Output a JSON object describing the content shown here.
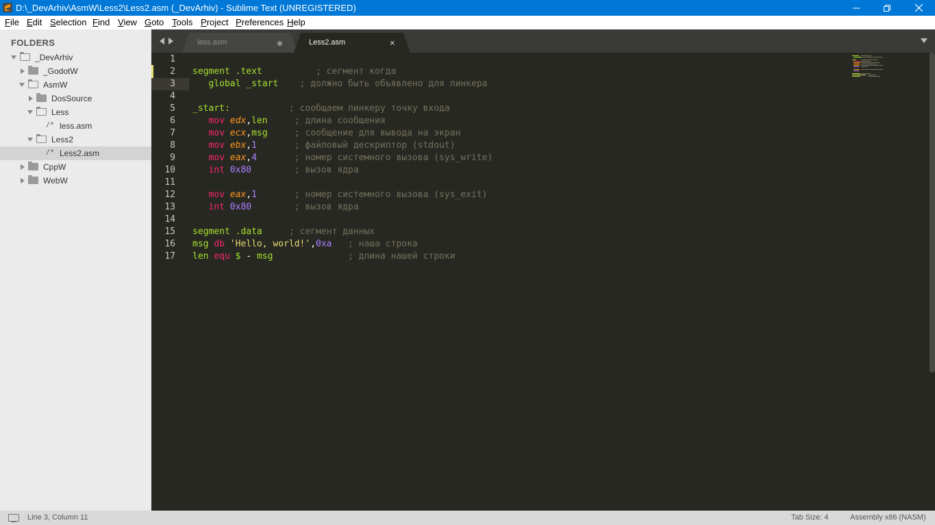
{
  "window": {
    "title": "D:\\_DevArhiv\\AsmW\\Less2\\Less2.asm (_DevArhiv) - Sublime Text (UNREGISTERED)"
  },
  "menu": [
    "File",
    "Edit",
    "Selection",
    "Find",
    "View",
    "Goto",
    "Tools",
    "Project",
    "Preferences",
    "Help"
  ],
  "sidebar": {
    "title": "FOLDERS",
    "tree": [
      {
        "label": "_DevArhiv",
        "type": "folder",
        "open": true
      },
      {
        "label": "_GodotW",
        "type": "folder",
        "open": false
      },
      {
        "label": "AsmW",
        "type": "folder",
        "open": true
      },
      {
        "label": "DosSource",
        "type": "folder",
        "open": false
      },
      {
        "label": "Less",
        "type": "folder",
        "open": true
      },
      {
        "label": "less.asm",
        "type": "file",
        "file_icon": "/*"
      },
      {
        "label": "Less2",
        "type": "folder",
        "open": true
      },
      {
        "label": "Less2.asm",
        "type": "file",
        "file_icon": "/*",
        "selected": true
      },
      {
        "label": "CppW",
        "type": "folder",
        "open": false
      },
      {
        "label": "WebW",
        "type": "folder",
        "open": false
      }
    ]
  },
  "tabs": [
    {
      "label": "less.asm",
      "active": false,
      "dirty": true
    },
    {
      "label": "Less2.asm",
      "active": true,
      "close": "×"
    }
  ],
  "editor": {
    "current_line": 3,
    "lines": [
      {
        "num": "1",
        "tokens": []
      },
      {
        "num": "2",
        "tokens": [
          [
            "kw",
            "segment .text"
          ],
          [
            "plain",
            "          "
          ],
          [
            "cmt",
            "; сегмент когда"
          ]
        ]
      },
      {
        "num": "3",
        "tokens": [
          [
            "plain",
            "   "
          ],
          [
            "kw",
            "global _start"
          ],
          [
            "plain",
            "    "
          ],
          [
            "cmt",
            "; должно быть объявлено для линкера"
          ]
        ]
      },
      {
        "num": "4",
        "tokens": []
      },
      {
        "num": "5",
        "tokens": [
          [
            "kw",
            "_start:"
          ],
          [
            "plain",
            "           "
          ],
          [
            "cmt",
            "; сообщаем линкеру точку входа"
          ]
        ]
      },
      {
        "num": "6",
        "tokens": [
          [
            "plain",
            "   "
          ],
          [
            "op",
            "mov "
          ],
          [
            "reg",
            "edx"
          ],
          [
            "plain",
            ","
          ],
          [
            "kw",
            "len"
          ],
          [
            "plain",
            "     "
          ],
          [
            "cmt",
            "; длина сообщения"
          ]
        ]
      },
      {
        "num": "7",
        "tokens": [
          [
            "plain",
            "   "
          ],
          [
            "op",
            "mov "
          ],
          [
            "reg",
            "ecx"
          ],
          [
            "plain",
            ","
          ],
          [
            "kw",
            "msg"
          ],
          [
            "plain",
            "     "
          ],
          [
            "cmt",
            "; сообщение для вывода на экран"
          ]
        ]
      },
      {
        "num": "8",
        "tokens": [
          [
            "plain",
            "   "
          ],
          [
            "op",
            "mov "
          ],
          [
            "reg",
            "ebx"
          ],
          [
            "plain",
            ","
          ],
          [
            "num",
            "1"
          ],
          [
            "plain",
            "       "
          ],
          [
            "cmt",
            "; файловый дескриптор (stdout)"
          ]
        ]
      },
      {
        "num": "9",
        "tokens": [
          [
            "plain",
            "   "
          ],
          [
            "op",
            "mov "
          ],
          [
            "reg",
            "eax"
          ],
          [
            "plain",
            ","
          ],
          [
            "num",
            "4"
          ],
          [
            "plain",
            "       "
          ],
          [
            "cmt",
            "; номер системного вызова (sys_write)"
          ]
        ]
      },
      {
        "num": "10",
        "tokens": [
          [
            "plain",
            "   "
          ],
          [
            "op",
            "int "
          ],
          [
            "num",
            "0x80"
          ],
          [
            "plain",
            "        "
          ],
          [
            "cmt",
            "; вызов ядра"
          ]
        ]
      },
      {
        "num": "11",
        "tokens": []
      },
      {
        "num": "12",
        "tokens": [
          [
            "plain",
            "   "
          ],
          [
            "op",
            "mov "
          ],
          [
            "reg",
            "eax"
          ],
          [
            "plain",
            ","
          ],
          [
            "num",
            "1"
          ],
          [
            "plain",
            "       "
          ],
          [
            "cmt",
            "; номер системного вызова (sys_exit)"
          ]
        ]
      },
      {
        "num": "13",
        "tokens": [
          [
            "plain",
            "   "
          ],
          [
            "op",
            "int "
          ],
          [
            "num",
            "0x80"
          ],
          [
            "plain",
            "        "
          ],
          [
            "cmt",
            "; вызов ядра"
          ]
        ]
      },
      {
        "num": "14",
        "tokens": []
      },
      {
        "num": "15",
        "tokens": [
          [
            "kw",
            "segment .data"
          ],
          [
            "plain",
            "     "
          ],
          [
            "cmt",
            "; сегмент данных"
          ]
        ]
      },
      {
        "num": "16",
        "tokens": [
          [
            "kw",
            "msg"
          ],
          [
            "plain",
            " "
          ],
          [
            "op",
            "db "
          ],
          [
            "str",
            "'Hello, world!'"
          ],
          [
            "plain",
            ","
          ],
          [
            "num",
            "0xa"
          ],
          [
            "plain",
            "   "
          ],
          [
            "cmt",
            "; наша строка"
          ]
        ]
      },
      {
        "num": "17",
        "tokens": [
          [
            "kw",
            "len"
          ],
          [
            "plain",
            " "
          ],
          [
            "op",
            "equ "
          ],
          [
            "kw",
            "$"
          ],
          [
            "plain",
            " - "
          ],
          [
            "kw",
            "msg"
          ],
          [
            "plain",
            "              "
          ],
          [
            "cmt",
            "; длина нашей строки"
          ]
        ]
      }
    ]
  },
  "status": {
    "position": "Line 3, Column 11",
    "tab_size": "Tab Size: 4",
    "syntax": "Assembly x86 (NASM)"
  },
  "colors": {
    "titlebar": "#0078d7",
    "editor_bg": "#272822",
    "keyword": "#a6e22e",
    "instruction": "#f92672",
    "register": "#fd971f",
    "number": "#ae81ff",
    "string": "#e6db74",
    "comment": "#75715e"
  }
}
